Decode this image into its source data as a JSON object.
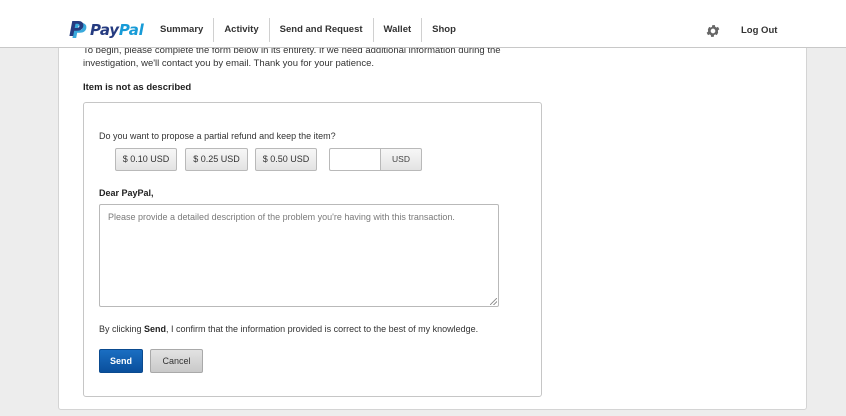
{
  "header": {
    "logo_pay": "Pay",
    "logo_pal": "Pal",
    "nav": [
      {
        "label": "Summary"
      },
      {
        "label": "Activity"
      },
      {
        "label": "Send and Request"
      },
      {
        "label": "Wallet"
      },
      {
        "label": "Shop"
      }
    ],
    "logout_label": "Log Out"
  },
  "intro": {
    "line1": "To begin, please complete the form below in its entirety. If we need additional information during the",
    "line2": "investigation, we'll contact you by email. Thank you for your patience."
  },
  "section_title": "Item is not as described",
  "form": {
    "question": "Do you want to propose a partial refund and keep the item?",
    "amounts": [
      "$ 0.10 USD",
      "$ 0.25 USD",
      "$ 0.50 USD"
    ],
    "custom_amount_value": "",
    "currency_label": "USD",
    "salutation": "Dear PayPal,",
    "description_placeholder": "Please provide a detailed description of the problem you're having with this transaction.",
    "confirm_prefix": "By clicking ",
    "confirm_keyword": "Send",
    "confirm_suffix": ", I confirm that the information provided is correct to the best of my knowledge.",
    "send_label": "Send",
    "cancel_label": "Cancel"
  },
  "colors": {
    "brand_dark_blue": "#253b80",
    "brand_light_blue": "#179bd7",
    "send_button": "#0a5bb0"
  }
}
